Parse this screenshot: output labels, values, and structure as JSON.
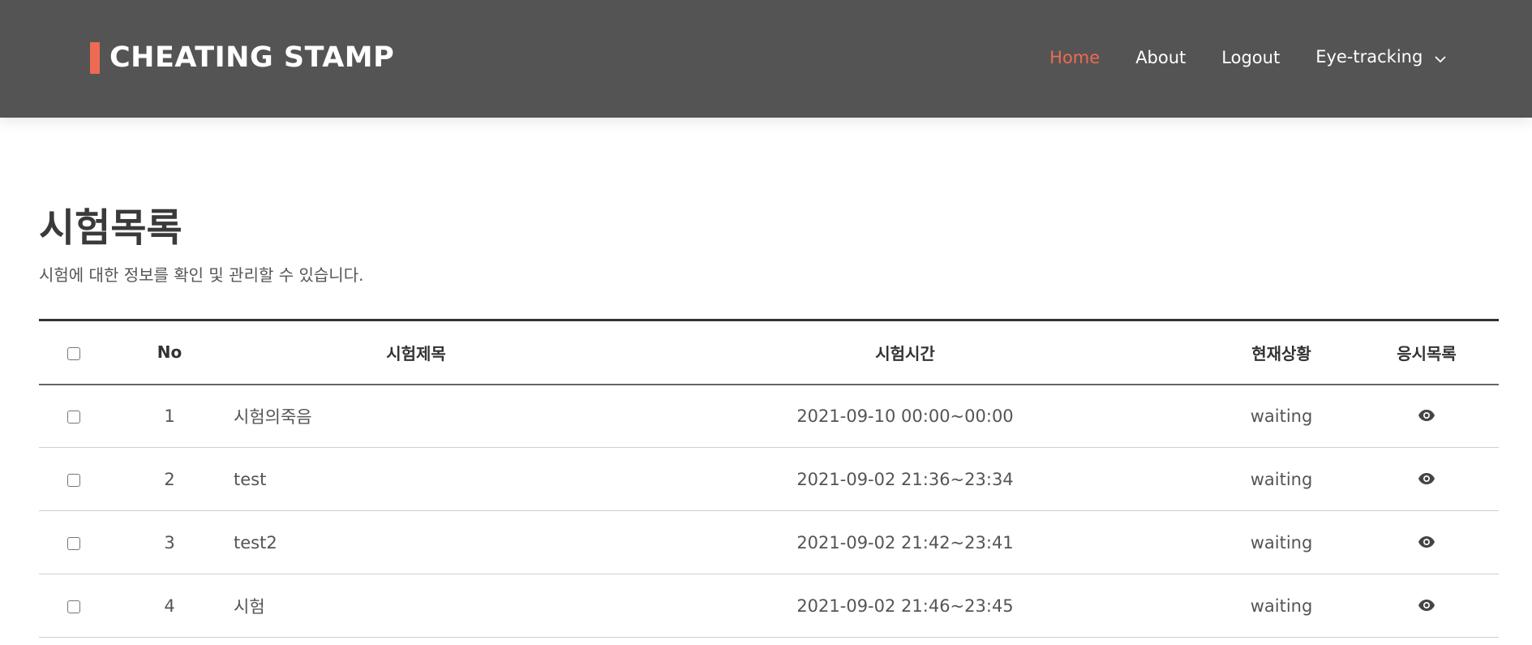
{
  "header": {
    "brand": "CHEATING STAMP",
    "nav": [
      {
        "label": "Home",
        "active": true
      },
      {
        "label": "About",
        "active": false
      },
      {
        "label": "Logout",
        "active": false
      },
      {
        "label": "Eye-tracking",
        "active": false,
        "dropdown": true
      }
    ]
  },
  "main": {
    "title": "시험목록",
    "description": "시험에 대한 정보를 확인 및 관리할 수 있습니다.",
    "table": {
      "columns": [
        "",
        "No",
        "시험제목",
        "시험시간",
        "현재상황",
        "응시목록"
      ],
      "rows": [
        {
          "no": "1",
          "title": "시험의죽음",
          "time": "2021-09-10 00:00~00:00",
          "status": "waiting",
          "action_icon": "eye-icon"
        },
        {
          "no": "2",
          "title": "test",
          "time": "2021-09-02 21:36~23:34",
          "status": "waiting",
          "action_icon": "eye-icon"
        },
        {
          "no": "3",
          "title": "test2",
          "time": "2021-09-02 21:42~23:41",
          "status": "waiting",
          "action_icon": "eye-icon"
        },
        {
          "no": "4",
          "title": "시험",
          "time": "2021-09-02 21:46~23:45",
          "status": "waiting",
          "action_icon": "eye-icon"
        }
      ]
    }
  },
  "colors": {
    "header_bg": "#545454",
    "accent": "#ee6a52",
    "text_dark": "#333333",
    "text_muted": "#555555"
  }
}
